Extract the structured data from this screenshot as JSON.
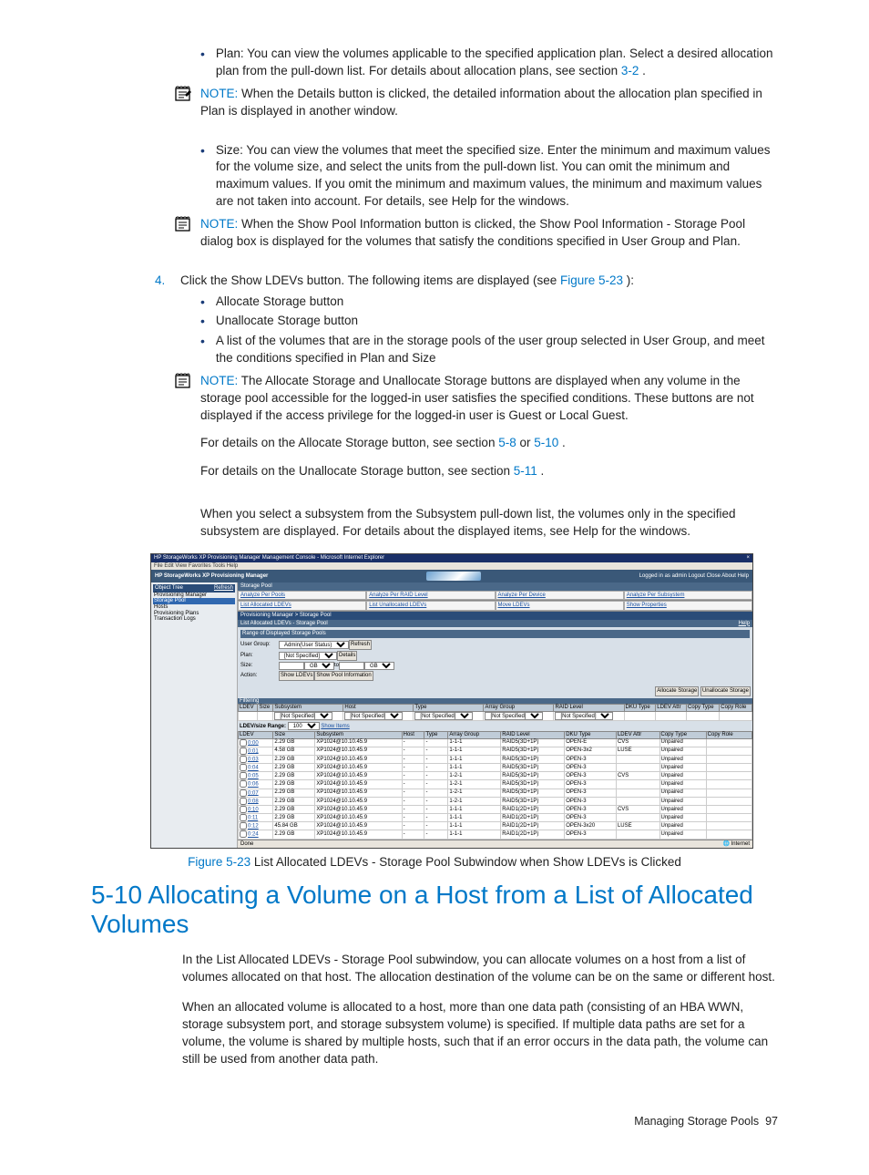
{
  "bullets1": {
    "plan": "Plan: You can view the volumes applicable to the specified application plan. Select a desired allocation plan from the pull-down list. For details about allocation plans, see section ",
    "plan_link": "3-2 ",
    "plan_tail": "."
  },
  "note1": {
    "label": "NOTE:  ",
    "text": "When the Details button is clicked, the detailed information about the allocation plan specified in Plan is displayed in another window."
  },
  "bullets2": {
    "size": "Size: You can view the volumes that meet the specified size. Enter the minimum and maximum values for the volume size, and select the units from the pull-down list. You can omit the minimum and maximum values. If you omit the minimum and maximum values, the minimum and maximum values are not taken into account. For details, see Help for the windows."
  },
  "note2": {
    "label": "NOTE:  ",
    "text": "When the Show Pool Information button is clicked, the Show Pool Information - Storage Pool dialog box is displayed for the volumes that satisfy the conditions specified in User Group and Plan."
  },
  "step4": {
    "num": "4.",
    "pre": "Click the Show LDEVs button. The following items are displayed (see ",
    "link": "Figure 5-23",
    "post": "):"
  },
  "step4_items": {
    "a": "Allocate Storage button",
    "b": "Unallocate Storage button",
    "c": "A list of the volumes that are in the storage pools of the user group selected in User Group, and meet the conditions specified in Plan and Size"
  },
  "note3": {
    "label": "NOTE:  ",
    "p1": "The Allocate Storage and Unallocate Storage buttons are displayed when any volume in the storage pool accessible for the logged-in user satisfies the specified conditions. These buttons are not displayed if the access privilege for the logged-in user is Guest or Local Guest.",
    "p2a": "For details on the Allocate Storage button, see section ",
    "p2l1": "5-8 ",
    "p2m": " or ",
    "p2l2": "5-10 ",
    "p2b": ".",
    "p3a": "For details on the Unallocate Storage button, see section ",
    "p3l": "5-11 ",
    "p3b": "."
  },
  "para_sub": "When you select a subsystem from the Subsystem pull-down list, the volumes only in the specified subsystem are displayed. For details about the displayed items, see Help for the windows.",
  "fig": {
    "link": "Figure 5-23",
    "caption": " List Allocated LDEVs - Storage Pool Subwindow when Show LDEVs is Clicked"
  },
  "heading": "5-10 Allocating a Volume on a Host from a List of Allocated Volumes",
  "body_p1": "In the List Allocated LDEVs - Storage Pool subwindow, you can allocate volumes on a host from a list of volumes allocated on that host. The allocation destination of the volume can be on the same or different host.",
  "body_p2": "When an allocated volume is allocated to a host, more than one data path (consisting of an HBA WWN, storage subsystem port, and storage subsystem volume) is specified. If multiple data paths are set for a volume, the volume is shared by multiple hosts, such that if an error occurs in the data path, the volume can still be used from another data path.",
  "footer": {
    "label": "Managing Storage Pools",
    "page": "97"
  },
  "shot": {
    "title": "HP StorageWorks XP Provisioning Manager Management Console - Microsoft Internet Explorer",
    "close": "×",
    "menu": "File  Edit  View  Favorites  Tools  Help",
    "brand": "HP StorageWorks XP Provisioning Manager",
    "userinfo": "Logged in as admin  Logout  Close  About  Help",
    "nav": {
      "head": "Object Tree",
      "refresh": "Refresh",
      "items": [
        "Provisioning Manager",
        "Storage Pool",
        "Hosts",
        "Provisioning Plans",
        "Transaction Logs"
      ]
    },
    "tabs": [
      [
        "Analyze Per Pools",
        "Analyze Per RAID Level",
        "Analyze Per Device",
        "Analyze Per Subsystem"
      ],
      [
        "List Allocated LDEVs",
        "List Unallocated LDEVs",
        "Move LDEVs",
        "Show Properties"
      ]
    ],
    "crumb": "Provisioning Manager > Storage Pool",
    "sub": "List Allocated LDEVs - Storage Pool",
    "help": "Help",
    "panel_title": "Range of Displayed Storage Pools",
    "form": {
      "ug_lab": "User Group:",
      "ug_val": "Admin(User Status)",
      "ug_btn": "Refresh",
      "plan_lab": "Plan:",
      "plan_val": "[Not Specified]",
      "plan_btn": "Details",
      "size_lab": "Size:",
      "size_mid": " to ",
      "size_unit": "GB",
      "act_lab": "Action:",
      "act_b1": "Show LDEVs",
      "act_b2": "Show Pool Information"
    },
    "btns": {
      "alloc": "Allocate Storage",
      "unalloc": "Unallocate Storage"
    },
    "filter_label": "Filtering",
    "cols": [
      "LDEV",
      "Size",
      "Subsystem",
      "Host",
      "Type",
      "Array Group",
      "RAID Level",
      "DKU Type",
      "LDEV Attr",
      "Copy Type",
      "Copy Role"
    ],
    "filter_vals": [
      "",
      "",
      "[Not Specified]",
      "[Not Specified]",
      "[Not Specified]",
      "[Not Specified]",
      "[Not Specified]",
      "",
      "",
      "",
      ""
    ],
    "pager": {
      "label": "LDEV/size  Range:",
      "val": "100",
      "show": "Show Items"
    },
    "rows": [
      {
        "ldev": "0:00",
        "size": "2.29 GB",
        "sub": "XP1024@10.10.45.9",
        "host": "-",
        "type": "-",
        "ag": "1-1-1",
        "raid": "RAID5(3D+1P)",
        "dku": "OPEN-E",
        "attr": "CVS",
        "ct": "Unpaired",
        "cr": ""
      },
      {
        "ldev": "0:01",
        "size": "4.58 GB",
        "sub": "XP1024@10.10.45.9",
        "host": "-",
        "type": "-",
        "ag": "1-1-1",
        "raid": "RAID5(3D+1P)",
        "dku": "OPEN-3x2",
        "attr": "LUSE",
        "ct": "Unpaired",
        "cr": ""
      },
      {
        "ldev": "0:03",
        "size": "2.29 GB",
        "sub": "XP1024@10.10.45.9",
        "host": "-",
        "type": "-",
        "ag": "1-1-1",
        "raid": "RAID5(3D+1P)",
        "dku": "OPEN-3",
        "attr": "",
        "ct": "Unpaired",
        "cr": ""
      },
      {
        "ldev": "0:04",
        "size": "2.29 GB",
        "sub": "XP1024@10.10.45.9",
        "host": "-",
        "type": "-",
        "ag": "1-1-1",
        "raid": "RAID5(3D+1P)",
        "dku": "OPEN-3",
        "attr": "",
        "ct": "Unpaired",
        "cr": ""
      },
      {
        "ldev": "0:05",
        "size": "2.29 GB",
        "sub": "XP1024@10.10.45.9",
        "host": "-",
        "type": "-",
        "ag": "1-2-1",
        "raid": "RAID5(3D+1P)",
        "dku": "OPEN-3",
        "attr": "CVS",
        "ct": "Unpaired",
        "cr": ""
      },
      {
        "ldev": "0:06",
        "size": "2.29 GB",
        "sub": "XP1024@10.10.45.9",
        "host": "-",
        "type": "-",
        "ag": "1-2-1",
        "raid": "RAID5(3D+1P)",
        "dku": "OPEN-3",
        "attr": "",
        "ct": "Unpaired",
        "cr": ""
      },
      {
        "ldev": "0:07",
        "size": "2.29 GB",
        "sub": "XP1024@10.10.45.9",
        "host": "-",
        "type": "-",
        "ag": "1-2-1",
        "raid": "RAID5(3D+1P)",
        "dku": "OPEN-3",
        "attr": "",
        "ct": "Unpaired",
        "cr": ""
      },
      {
        "ldev": "0:08",
        "size": "2.29 GB",
        "sub": "XP1024@10.10.45.9",
        "host": "-",
        "type": "-",
        "ag": "1-2-1",
        "raid": "RAID5(3D+1P)",
        "dku": "OPEN-3",
        "attr": "",
        "ct": "Unpaired",
        "cr": ""
      },
      {
        "ldev": "0:10",
        "size": "2.29 GB",
        "sub": "XP1024@10.10.45.9",
        "host": "-",
        "type": "-",
        "ag": "1-1-1",
        "raid": "RAID1(2D+1P)",
        "dku": "OPEN-3",
        "attr": "CVS",
        "ct": "Unpaired",
        "cr": ""
      },
      {
        "ldev": "0:11",
        "size": "2.29 GB",
        "sub": "XP1024@10.10.45.9",
        "host": "-",
        "type": "-",
        "ag": "1-1-1",
        "raid": "RAID1(2D+1P)",
        "dku": "OPEN-3",
        "attr": "",
        "ct": "Unpaired",
        "cr": ""
      },
      {
        "ldev": "0:12",
        "size": "45.84 GB",
        "sub": "XP1024@10.10.45.9",
        "host": "-",
        "type": "-",
        "ag": "1-1-1",
        "raid": "RAID1(2D+1P)",
        "dku": "OPEN-3x20",
        "attr": "LUSE",
        "ct": "Unpaired",
        "cr": ""
      },
      {
        "ldev": "0:24",
        "size": "2.29 GB",
        "sub": "XP1024@10.10.45.9",
        "host": "-",
        "type": "-",
        "ag": "1-1-1",
        "raid": "RAID1(2D+1P)",
        "dku": "OPEN-3",
        "attr": "",
        "ct": "Unpaired",
        "cr": ""
      }
    ],
    "done": "Done",
    "internet": "Internet"
  }
}
